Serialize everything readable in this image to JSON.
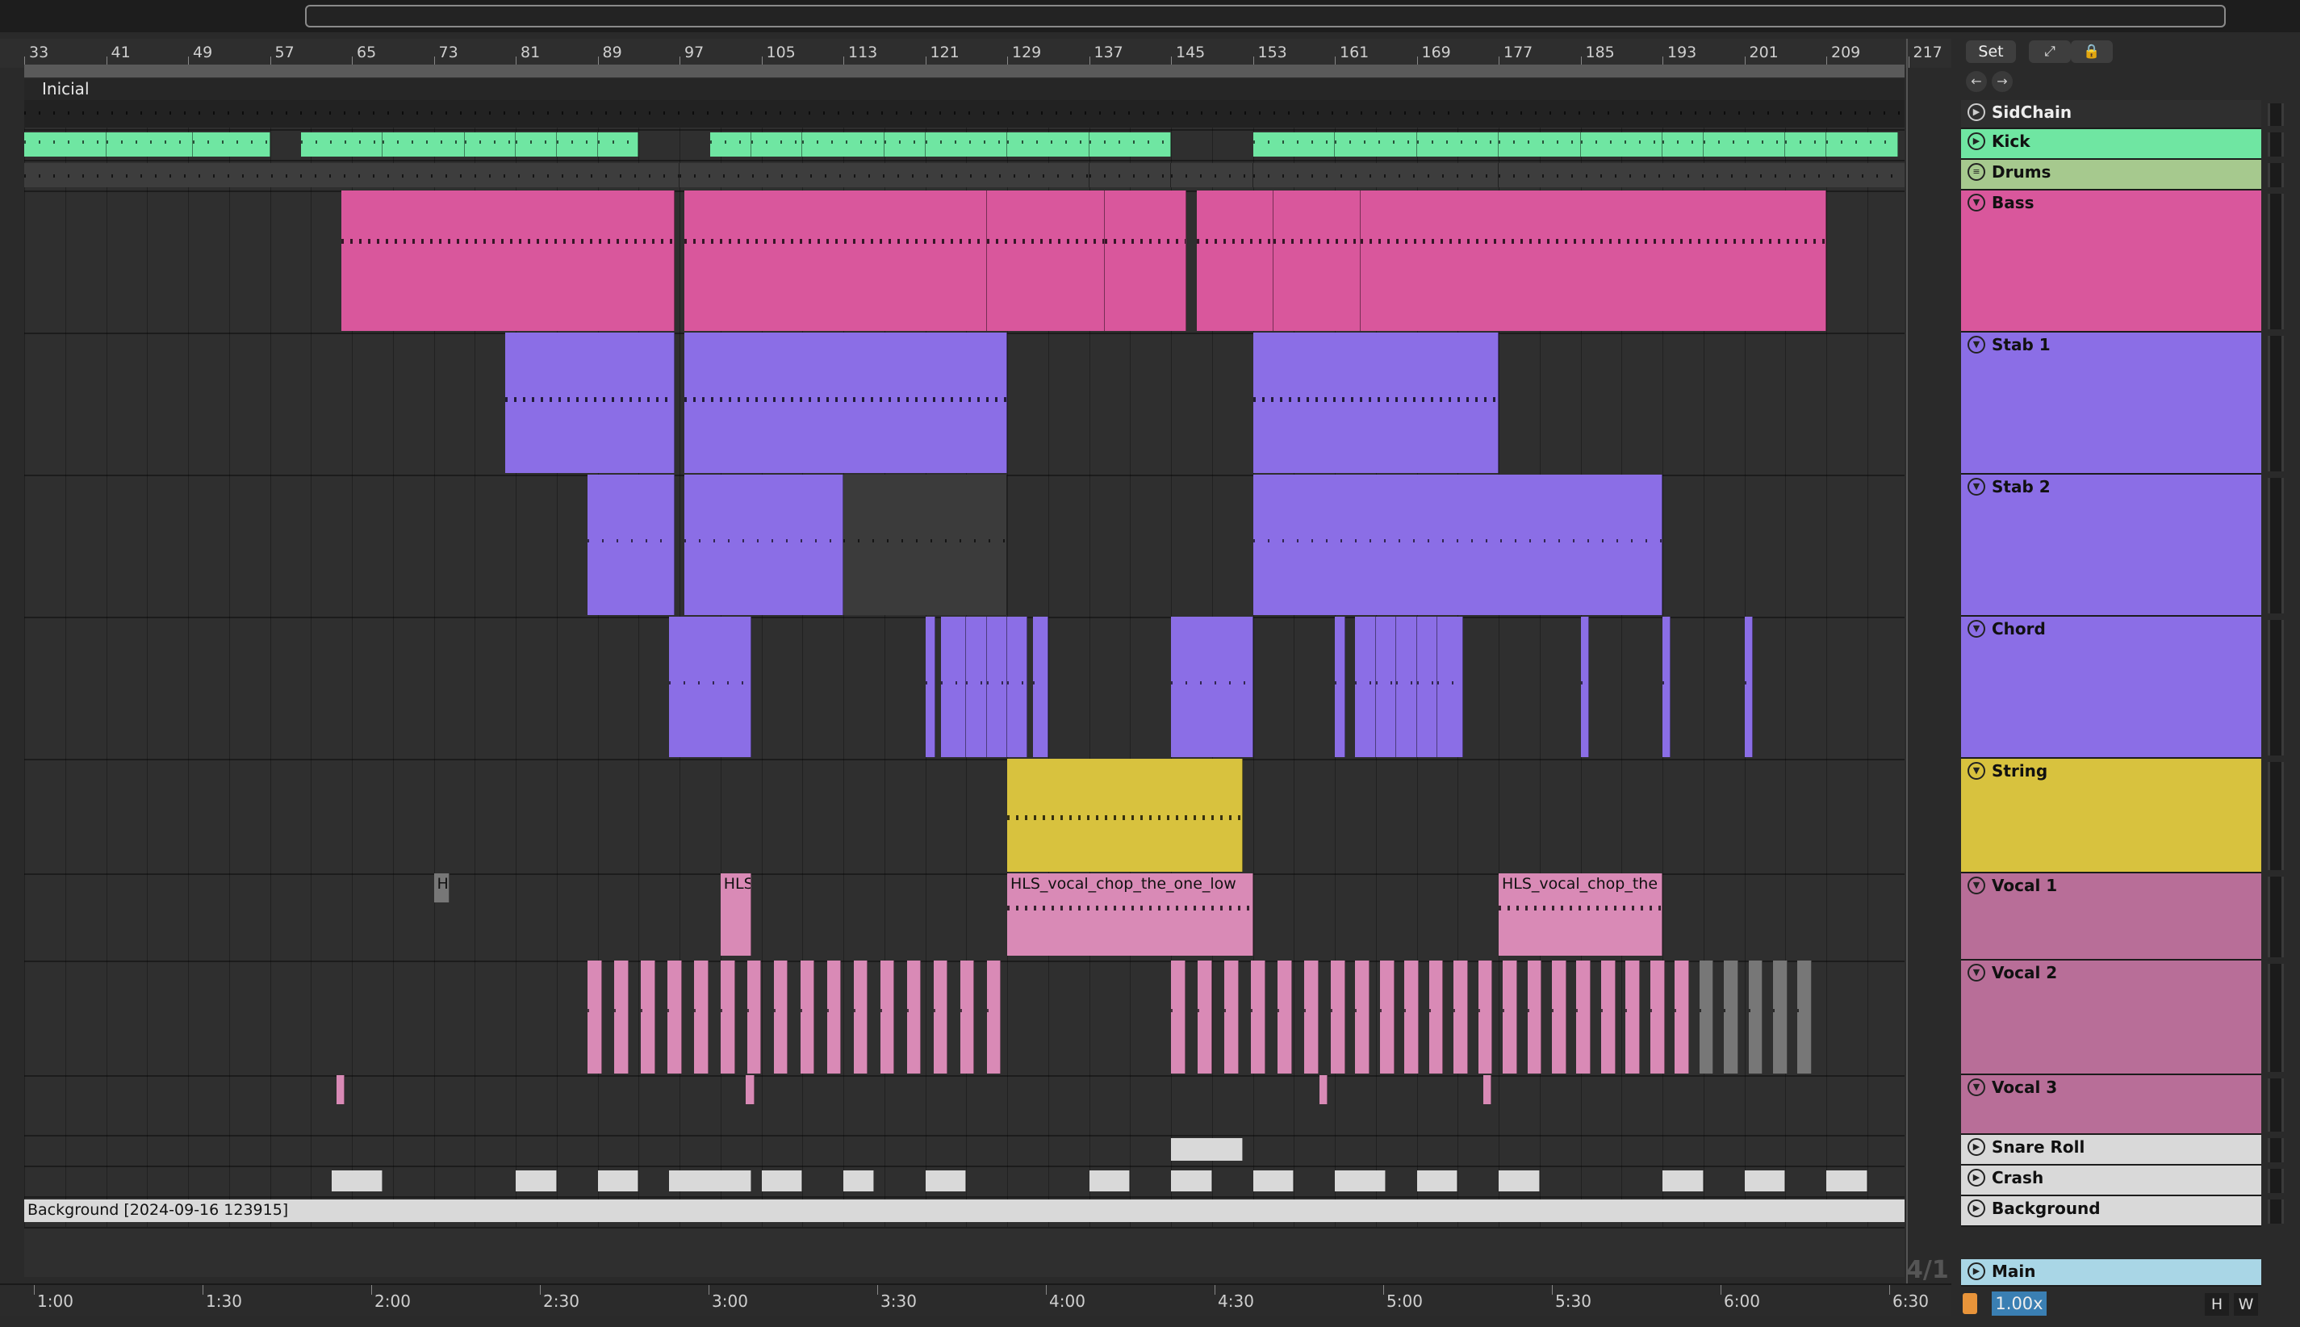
{
  "bar_labels": [
    "33",
    "41",
    "49",
    "57",
    "65",
    "73",
    "81",
    "89",
    "97",
    "105",
    "113",
    "121",
    "129",
    "137",
    "145",
    "153",
    "161",
    "169",
    "177",
    "185",
    "193",
    "201",
    "209",
    "217"
  ],
  "time_labels": [
    "1:00",
    "1:30",
    "2:00",
    "2:30",
    "3:00",
    "3:30",
    "4:00",
    "4:30",
    "5:00",
    "5:30",
    "6:00",
    "6:30"
  ],
  "locator": "Inicial",
  "header": {
    "set": "Set",
    "expand_icon": "expand-icon",
    "lock_icon": "lock-icon",
    "back_icon": "arrow-left-icon",
    "forward_icon": "arrow-right-icon"
  },
  "tracks": [
    {
      "name": "SidChain",
      "color": "#2f2f2f",
      "icon": "play-icon"
    },
    {
      "name": "Kick",
      "color": "#6fe6a2",
      "icon": "play-icon"
    },
    {
      "name": "Drums",
      "color": "#a6c98e",
      "icon": "group-icon"
    },
    {
      "name": "Bass",
      "color": "#d9579c",
      "icon": "fold-icon"
    },
    {
      "name": "Stab 1",
      "color": "#8b6ee6",
      "icon": "fold-icon"
    },
    {
      "name": "Stab 2",
      "color": "#8b6ee6",
      "icon": "fold-icon"
    },
    {
      "name": "Chord",
      "color": "#8b6ee6",
      "icon": "fold-icon"
    },
    {
      "name": "String",
      "color": "#d8c23e",
      "icon": "fold-icon"
    },
    {
      "name": "Vocal 1",
      "color": "#b86e98",
      "icon": "fold-icon"
    },
    {
      "name": "Vocal 2",
      "color": "#b86e98",
      "icon": "fold-icon"
    },
    {
      "name": "Vocal 3",
      "color": "#b86e98",
      "icon": "fold-icon"
    },
    {
      "name": "Snare Roll",
      "color": "#d9d9d9",
      "icon": "play-icon"
    },
    {
      "name": "Crash",
      "color": "#d9d9d9",
      "icon": "play-icon"
    },
    {
      "name": "Background",
      "color": "#d9d9d9",
      "icon": "play-icon"
    }
  ],
  "main_track": {
    "name": "Main",
    "color": "#a9d6e6"
  },
  "clips": {
    "vocal1_a": "H",
    "vocal1_b": "HLS",
    "vocal1_c": "HLS_vocal_chop_the_one_low",
    "vocal1_d": "HLS_vocal_chop_the",
    "background": "Background [2024-09-16 123915]"
  },
  "footer": {
    "signature": "4/1",
    "speed": "1.00x",
    "h_button": "H",
    "w_button": "W"
  }
}
